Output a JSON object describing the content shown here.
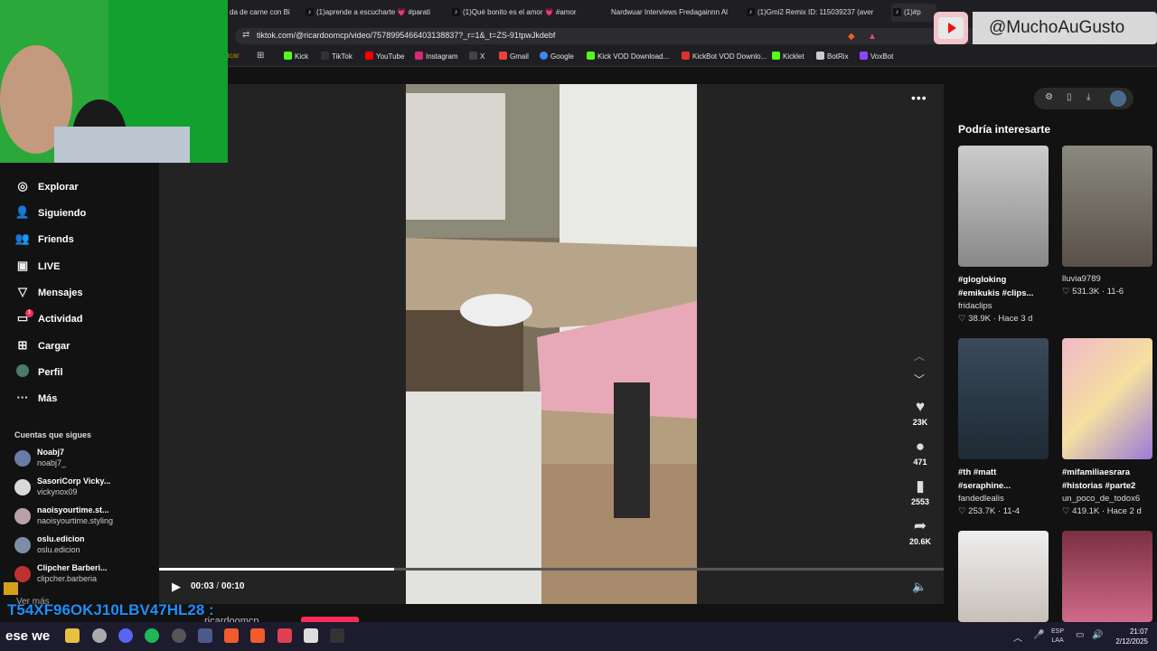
{
  "browser": {
    "tabs": [
      {
        "label": "da de carne con Bi"
      },
      {
        "label": "(1)aprende a escucharte 💗 #parati"
      },
      {
        "label": "(1)Qué bonito es el amor 💗 #amor"
      },
      {
        "label": "Nardwuar Interviews Fredagainnn Al"
      },
      {
        "label": "(1)Gmi2 Remix ID: 115039237 (aver"
      },
      {
        "label": "(1)#p"
      }
    ],
    "url": "tiktok.com/@ricardoomcp/video/7578995466403138837?_r=1&_t=ZS-91tpwJkdebf",
    "bookmarks": [
      {
        "label": "licar",
        "color": "#c58a00"
      },
      {
        "label": "Kick",
        "color": "#53fc18"
      },
      {
        "label": "TikTok",
        "color": "#111111"
      },
      {
        "label": "YouTube",
        "color": "#ff0000"
      },
      {
        "label": "Instagram",
        "color": "#d62976"
      },
      {
        "label": "X",
        "color": "#000000"
      },
      {
        "label": "Gmail",
        "color": "#ea4335"
      },
      {
        "label": "Google",
        "color": "#4285f4"
      },
      {
        "label": "Kick VOD Download...",
        "color": "#53fc18"
      },
      {
        "label": "KickBot VOD Downlo...",
        "color": "#e03030"
      },
      {
        "label": "Kicklet",
        "color": "#53fc18"
      },
      {
        "label": "BotRix",
        "color": "#cccccc"
      },
      {
        "label": "VoxBot",
        "color": "#8e44ff"
      }
    ]
  },
  "sidebar": {
    "items": [
      {
        "label": "Explorar",
        "icon": "compass-icon"
      },
      {
        "label": "Siguiendo",
        "icon": "following-icon"
      },
      {
        "label": "Friends",
        "icon": "friends-icon"
      },
      {
        "label": "LIVE",
        "icon": "live-icon"
      },
      {
        "label": "Mensajes",
        "icon": "messages-icon"
      },
      {
        "label": "Actividad",
        "icon": "activity-icon",
        "badge": "1"
      },
      {
        "label": "Cargar",
        "icon": "upload-icon"
      },
      {
        "label": "Perfil",
        "icon": "profile-icon"
      },
      {
        "label": "Más",
        "icon": "more-icon"
      }
    ],
    "following_title": "Cuentas que sigues",
    "accounts": [
      {
        "name": "Noabj7",
        "handle": "noabj7_",
        "color": "#6a7ba8"
      },
      {
        "name": "SasoriCorp Vicky...",
        "handle": "vickynox09",
        "color": "#d9d9d9"
      },
      {
        "name": "naoisyourtime.st...",
        "handle": "naoisyourtime.styling",
        "color": "#b8a0a8"
      },
      {
        "name": "oslu.edicion",
        "handle": "oslu.edicion",
        "color": "#7d8da8"
      },
      {
        "name": "Clipcher Barberi...",
        "handle": "clipcher.barberia",
        "color": "#c03030"
      }
    ],
    "see_more": "Ver más"
  },
  "player": {
    "likes": "23K",
    "comments": "471",
    "saves": "2553",
    "shares": "20.6K",
    "time_current": "00:03",
    "time_total": "00:10",
    "progress_fraction": 0.3,
    "author": "ricardoomcp"
  },
  "recommendations": {
    "title": "Podría interesarte",
    "cards": [
      {
        "caption1": "#glogloking",
        "caption2": "#emikukis #clips...",
        "user": "fridaclips",
        "meta": "♡ 38.9K · Hace 3 d"
      },
      {
        "caption1": "",
        "caption2": "",
        "user": "lluvia9789",
        "meta": "♡ 531.3K · 11-6"
      },
      {
        "caption1": "#th #matt",
        "caption2": "#seraphine...",
        "user": "fandedlealis",
        "meta": "♡ 253.7K · 11-4"
      },
      {
        "caption1": "#mifamiliaesrara",
        "caption2": "#historias #parte2",
        "user": "un_poco_de_todox6",
        "meta": "♡ 419.1K · Hace 2 d"
      }
    ]
  },
  "overlay": {
    "youtube_handle": "@MuchoAuGusto",
    "code": "T54XF96OKJ10LBV47HL28"
  },
  "taskbar": {
    "start_text": "ese we",
    "lang1": "ESP",
    "lang2": "LAA",
    "time": "21:07",
    "date": "2/12/2025"
  }
}
